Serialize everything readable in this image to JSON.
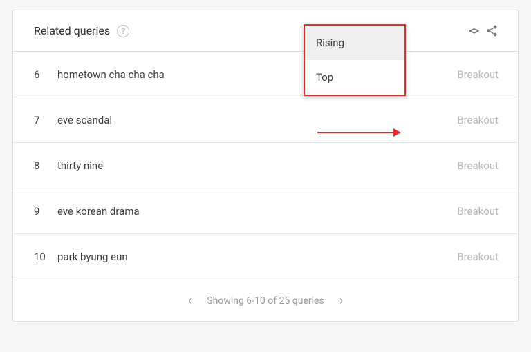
{
  "header": {
    "title": "Related queries"
  },
  "dropdown": {
    "options": [
      {
        "label": "Rising",
        "selected": true
      },
      {
        "label": "Top",
        "selected": false
      }
    ]
  },
  "rows": [
    {
      "rank": "6",
      "text": "hometown cha cha cha",
      "badge": "Breakout"
    },
    {
      "rank": "7",
      "text": "eve scandal",
      "badge": "Breakout"
    },
    {
      "rank": "8",
      "text": "thirty nine",
      "badge": "Breakout"
    },
    {
      "rank": "9",
      "text": "eve korean drama",
      "badge": "Breakout"
    },
    {
      "rank": "10",
      "text": "park byung eun",
      "badge": "Breakout"
    }
  ],
  "pager": {
    "text": "Showing 6-10 of 25 queries"
  },
  "annotation_color": "#ec2b27"
}
